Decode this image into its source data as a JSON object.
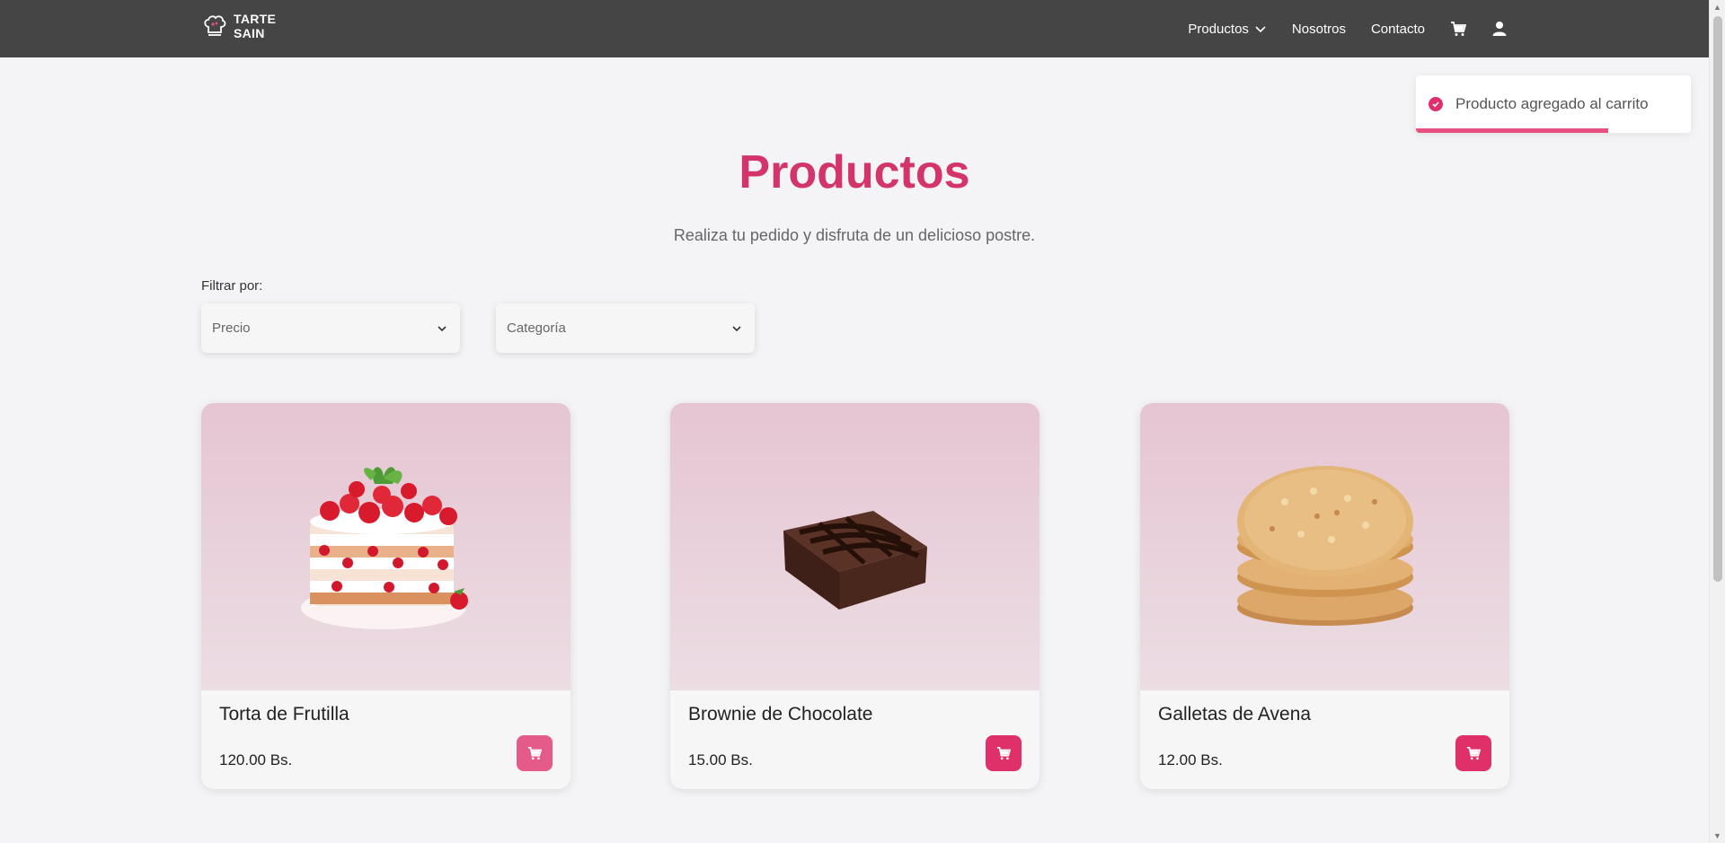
{
  "header": {
    "logo_line1": "TARTE",
    "logo_line2": "SAIN",
    "nav": {
      "productos": "Productos",
      "nosotros": "Nosotros",
      "contacto": "Contacto"
    }
  },
  "toast": {
    "message": "Producto agregado al carrito",
    "progress": 0.7
  },
  "main": {
    "title": "Productos",
    "subtitle": "Realiza tu pedido y disfruta de un delicioso postre."
  },
  "filters": {
    "label": "Filtrar por:",
    "price_placeholder": "Precio",
    "category_placeholder": "Categoría"
  },
  "products": [
    {
      "name": "Torta de Frutilla",
      "price": "120.00 Bs."
    },
    {
      "name": "Brownie de Chocolate",
      "price": "15.00 Bs."
    },
    {
      "name": "Galletas de Avena",
      "price": "12.00 Bs."
    }
  ],
  "colors": {
    "brand_pink": "#d3356a",
    "button_pink": "#e0306a",
    "navbar": "#454545"
  }
}
